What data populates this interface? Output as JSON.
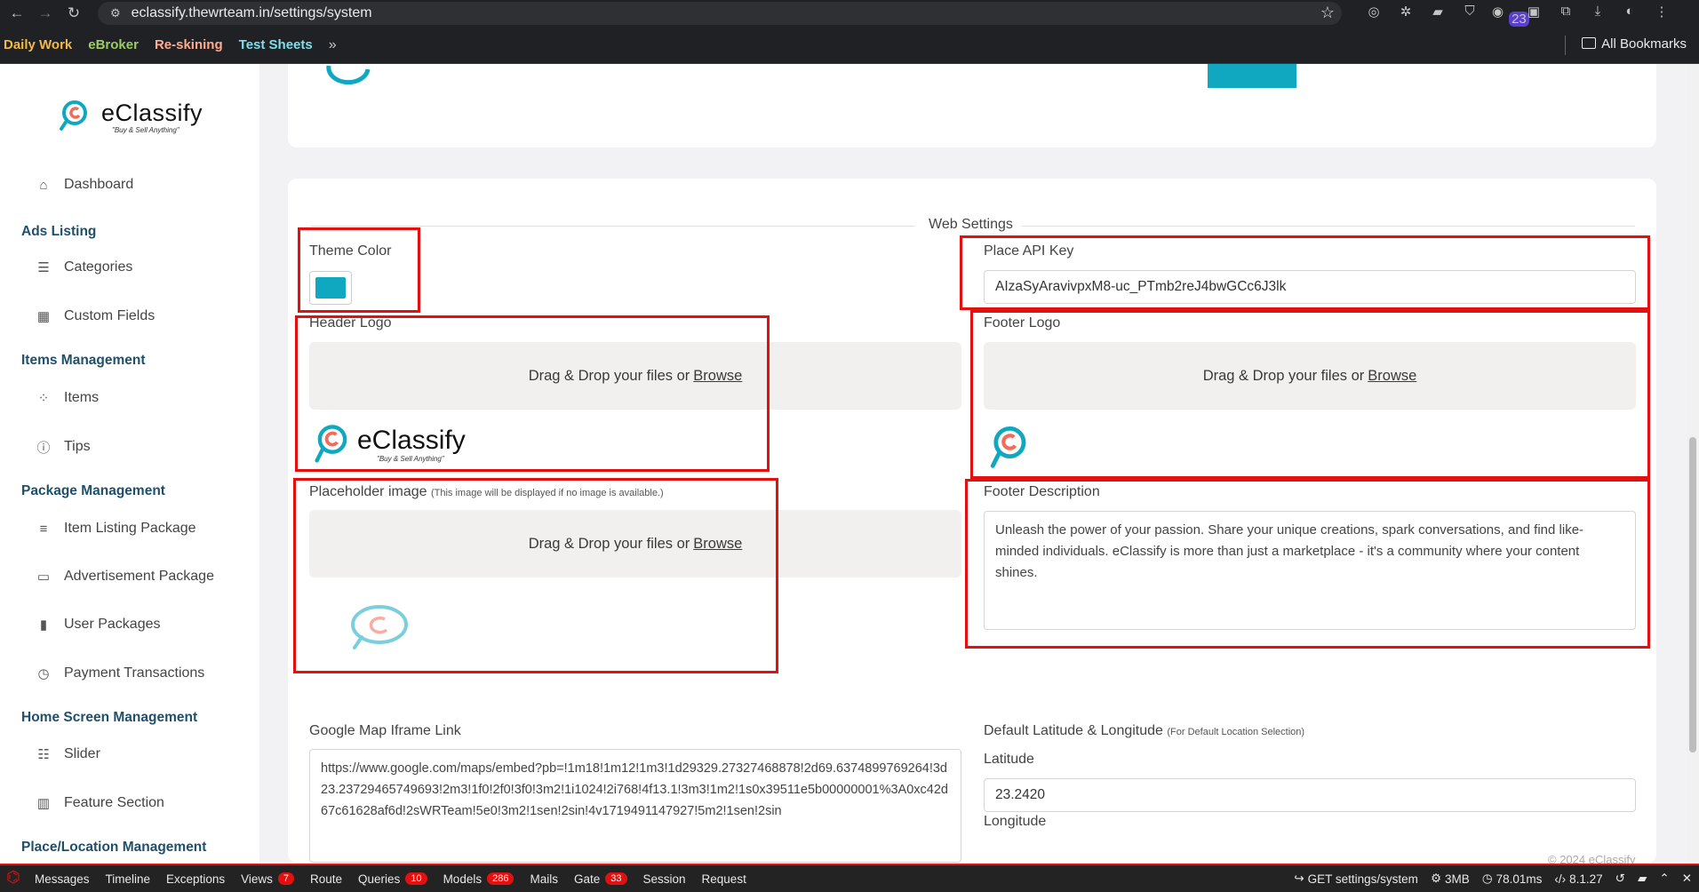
{
  "browser": {
    "url": "eclassify.thewrteam.in/settings/system",
    "bookmarks": [
      "Daily Work",
      "eBroker",
      "Re-skining",
      "Test Sheets"
    ],
    "more": "»",
    "all_bookmarks": "All Bookmarks",
    "ext_badge": "23"
  },
  "sidebar": {
    "logo_text": "eClassify",
    "logo_tagline": "\"Buy & Sell Anything\"",
    "dashboard": "Dashboard",
    "ads_listing": "Ads Listing",
    "categories": "Categories",
    "custom_fields": "Custom Fields",
    "items_management": "Items Management",
    "items": "Items",
    "tips": "Tips",
    "package_management": "Package Management",
    "item_listing_package": "Item Listing Package",
    "advertisement_package": "Advertisement Package",
    "user_packages": "User Packages",
    "payment_transactions": "Payment Transactions",
    "home_screen_management": "Home Screen Management",
    "slider": "Slider",
    "feature_section": "Feature Section",
    "place_location_management": "Place/Location Management"
  },
  "web_settings": {
    "legend": "Web Settings",
    "theme_color_label": "Theme Color",
    "theme_color": "#10a8c0",
    "place_api_key_label": "Place API Key",
    "place_api_key": "AIzaSyAravivpxM8-uc_PTmb2reJ4bwGCc6J3lk",
    "header_logo_label": "Header Logo",
    "footer_logo_label": "Footer Logo",
    "dropzone_text": "Drag & Drop your files or",
    "browse": "Browse",
    "placeholder_label": "Placeholder image",
    "placeholder_note": "(This image will be displayed if no image is available.)",
    "footer_description_label": "Footer Description",
    "footer_description": "Unleash the power of your passion. Share your unique creations, spark conversations, and find like-minded individuals. eClassify is more than just a marketplace - it's a community where your content shines.",
    "logo_text": "eClassify",
    "logo_tagline": "\"Buy & Sell Anything\"",
    "map_label": "Google Map Iframe Link",
    "map_value": "https://www.google.com/maps/embed?pb=!1m18!1m12!1m3!1d29329.27327468878!2d69.6374899769264!3d23.23729465749693!2m3!1f0!2f0!3f0!3m2!1i1024!2i768!4f13.1!3m3!1m2!1s0x39511e5b00000001%3A0xc42d67c61628af6d!2sWRTeam!5e0!3m2!1sen!2sin!4v1719491147927!5m2!1sen!2sin",
    "default_latlng_label": "Default Latitude & Longitude",
    "default_latlng_note": "(For Default Location Selection)",
    "latitude_label": "Latitude",
    "latitude": "23.2420",
    "longitude_label": "Longitude",
    "copyright": "© 2024 eClassify"
  },
  "debugbar": {
    "messages": "Messages",
    "timeline": "Timeline",
    "exceptions": "Exceptions",
    "views": "Views",
    "views_count": "7",
    "route": "Route",
    "queries": "Queries",
    "queries_count": "10",
    "models": "Models",
    "models_count": "286",
    "mails": "Mails",
    "gate": "Gate",
    "gate_count": "33",
    "session": "Session",
    "request": "Request",
    "route_info": "GET settings/system",
    "memory": "3MB",
    "time": "78.01ms",
    "php_version": "8.1.27"
  }
}
